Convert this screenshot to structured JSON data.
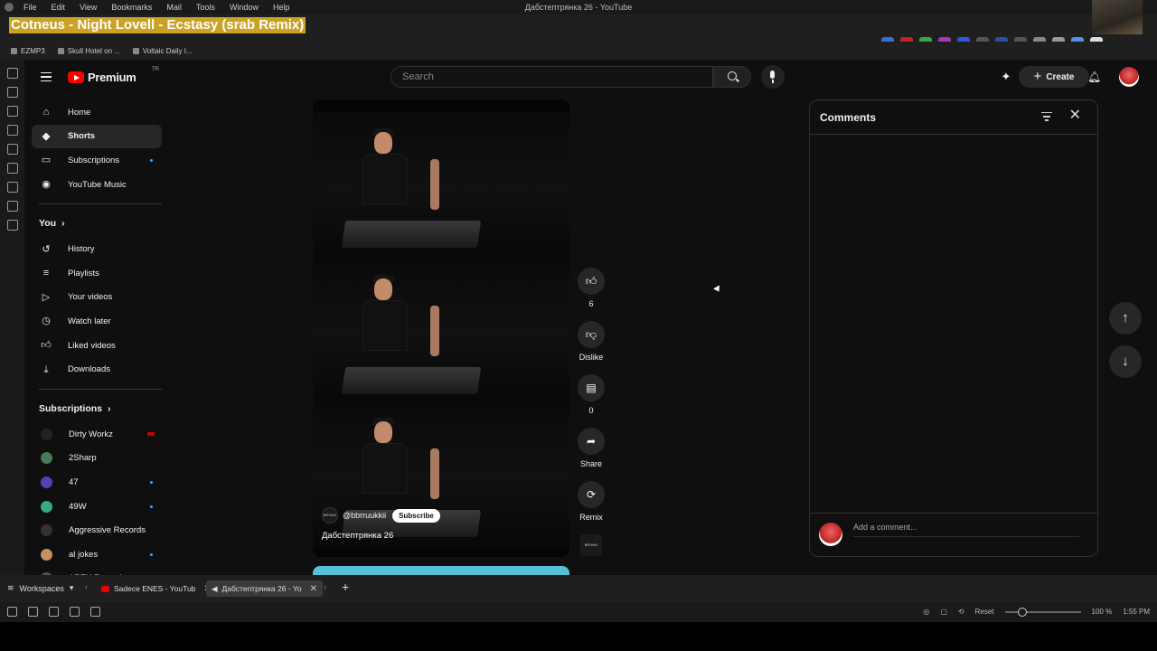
{
  "os_menu": {
    "items": [
      "File",
      "Edit",
      "View",
      "Bookmarks",
      "Mail",
      "Tools",
      "Window",
      "Help"
    ],
    "window_title": "Дабстептрянка 26 - YouTube"
  },
  "now_playing": "Cotneus - Night Lovell - Ecstasy (srab Remix)",
  "bookmarks": [
    "EZMP3",
    "Skull Hotel on ...",
    "Voltaic Daily I..."
  ],
  "masthead": {
    "logo_text": "Premium",
    "country_code": "TR",
    "search_placeholder": "Search",
    "create_label": "Create"
  },
  "guide": {
    "main": [
      {
        "label": "Home",
        "icon": "home-icon"
      },
      {
        "label": "Shorts",
        "icon": "shorts-icon",
        "active": true
      },
      {
        "label": "Subscriptions",
        "icon": "subscriptions-icon",
        "dot": true
      },
      {
        "label": "YouTube Music",
        "icon": "music-icon"
      }
    ],
    "you_header": "You",
    "you": [
      {
        "label": "History",
        "icon": "history-icon"
      },
      {
        "label": "Playlists",
        "icon": "playlists-icon"
      },
      {
        "label": "Your videos",
        "icon": "your-videos-icon"
      },
      {
        "label": "Watch later",
        "icon": "watch-later-icon"
      },
      {
        "label": "Liked videos",
        "icon": "liked-icon"
      },
      {
        "label": "Downloads",
        "icon": "download-icon"
      }
    ],
    "subs_header": "Subscriptions",
    "subscriptions": [
      {
        "label": "Dirty Workz",
        "badge": "live",
        "color": "#222222"
      },
      {
        "label": "2Sharp",
        "color": "#4a7a5a"
      },
      {
        "label": "47",
        "badge": "dot",
        "color": "#5b3fb0"
      },
      {
        "label": "49W",
        "badge": "dot",
        "color": "#3aa88a"
      },
      {
        "label": "Aggressive Records",
        "color": "#333333"
      },
      {
        "label": "al jokes",
        "badge": "dot",
        "color": "#c89060"
      },
      {
        "label": "APEX Records",
        "color": "#555555"
      }
    ]
  },
  "short": {
    "channel_avatar_text": "BR%KK",
    "channel": "@bbrruukkii",
    "subscribe": "Subscribe",
    "title": "Дабстептрянка 26"
  },
  "actions": {
    "like_count": "6",
    "dislike_label": "Dislike",
    "comment_count": "0",
    "share_label": "Share",
    "remix_label": "Remix",
    "sound_thumb_text": "BR%KK"
  },
  "comments": {
    "title": "Comments",
    "add_placeholder": "Add a comment..."
  },
  "tabbar": {
    "workspaces": "Workspaces",
    "tabs": [
      {
        "label": "Sadece ENES - YouTub"
      },
      {
        "label": "Дабстептрянка 26 - Yo"
      }
    ]
  },
  "statusbar": {
    "reset": "Reset",
    "zoom": "100 %",
    "time": "1:55 PM"
  },
  "colors": {
    "accent_red": "#ff0000",
    "badge_blue": "#3ea6ff",
    "now_playing_bg": "#c9a227"
  }
}
